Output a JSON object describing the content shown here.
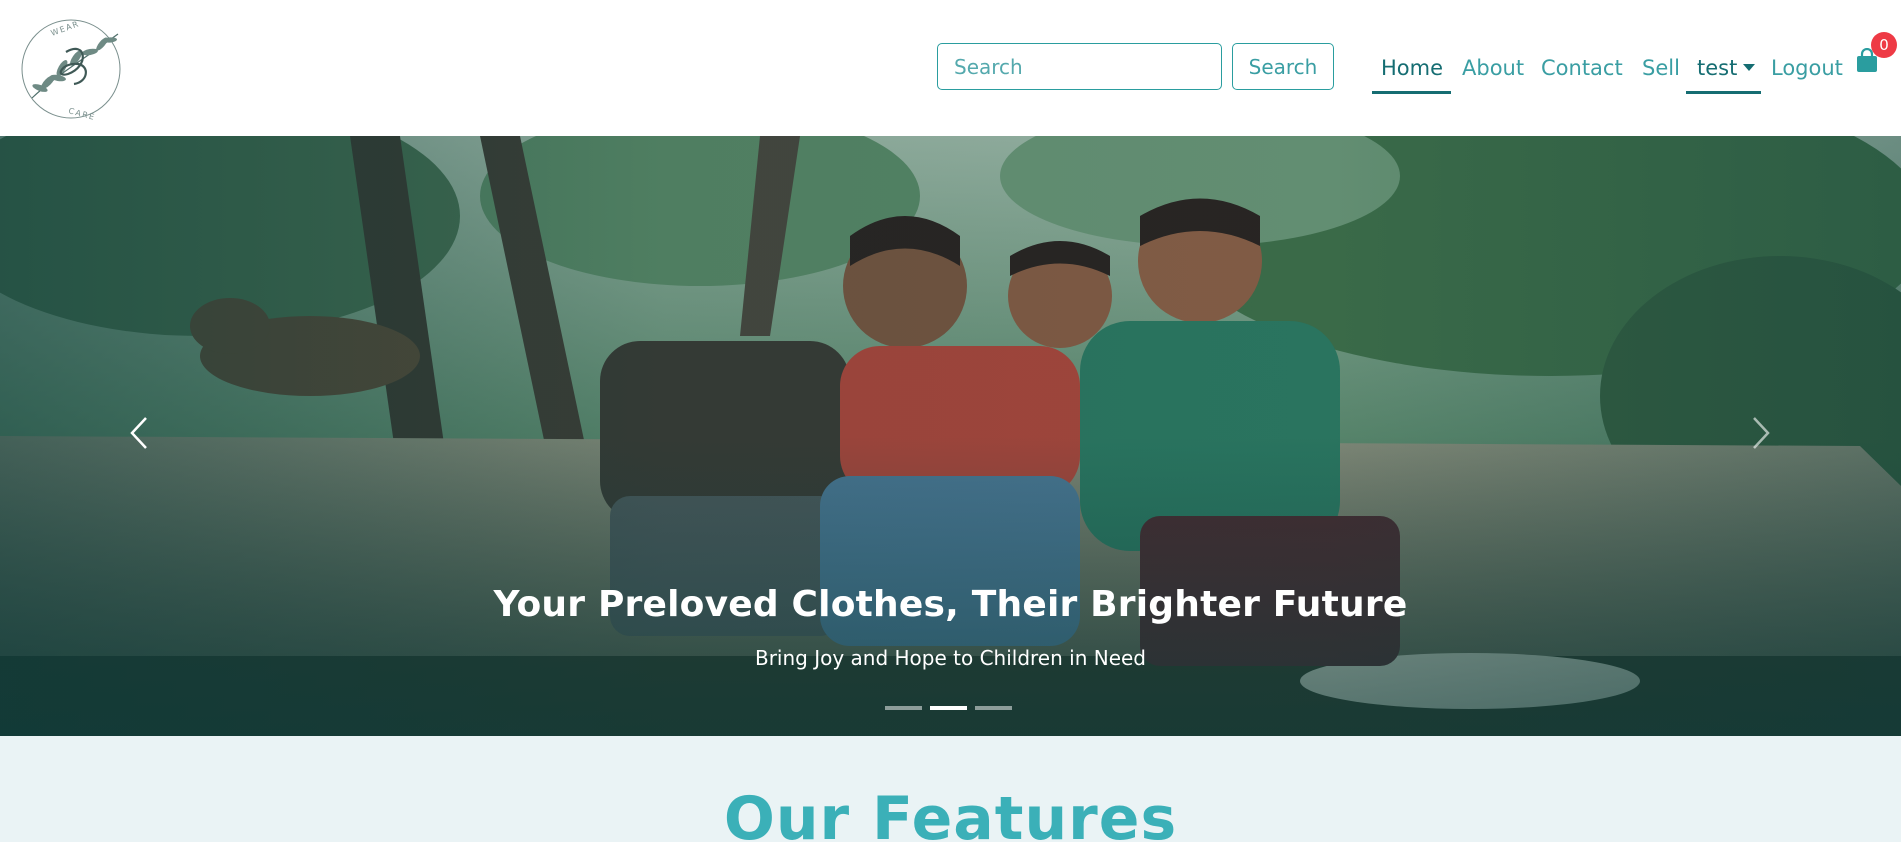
{
  "logo": {
    "top_text": "WEAR",
    "bottom_text": "CARE"
  },
  "search": {
    "placeholder": "Search",
    "value": "",
    "button_label": "Search"
  },
  "nav": {
    "items": [
      {
        "label": "Home",
        "active": true
      },
      {
        "label": "About"
      },
      {
        "label": "Contact"
      },
      {
        "label": "Sell"
      },
      {
        "label": "test",
        "dropdown": true
      },
      {
        "label": "Logout"
      }
    ],
    "cart_icon": "shopping-bag-icon",
    "cart_count": "0"
  },
  "hero": {
    "title": "Your Preloved Clothes, Their Brighter Future",
    "subtitle": "Bring Joy and Hope to Children in Need",
    "prev_icon": "chevron-left-icon",
    "next_icon": "chevron-right-icon",
    "active_slide": 2,
    "slide_count": 3
  },
  "features": {
    "title": "Our Features"
  },
  "colors": {
    "accent": "#2a9d9f",
    "dark_accent": "#156d72",
    "badge": "#ee3a45",
    "section_bg": "#eaf3f5",
    "heading": "#3bb0b8"
  }
}
